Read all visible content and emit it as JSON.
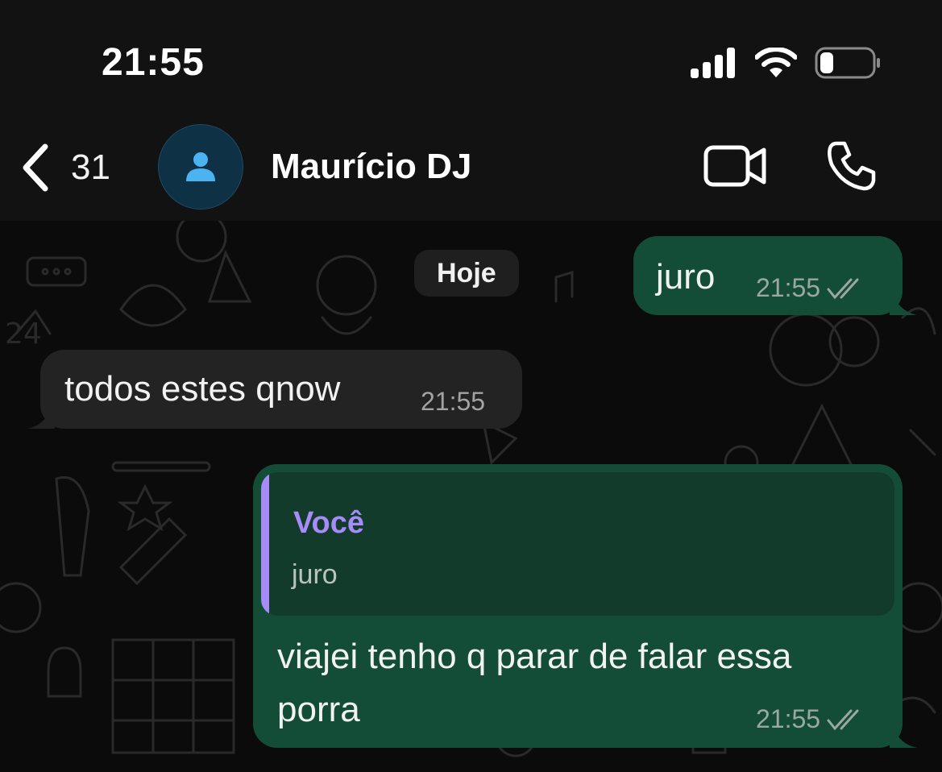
{
  "status_bar": {
    "time": "21:55"
  },
  "header": {
    "back_count": "31",
    "contact_name": "Maurício DJ",
    "icons": {
      "back": "chevron-left-icon",
      "avatar": "person-icon",
      "video": "video-camera-icon",
      "call": "phone-icon"
    }
  },
  "chat": {
    "date_chip": "Hoje",
    "messages": [
      {
        "direction": "outgoing",
        "text": "juro",
        "time": "21:55",
        "status": "read"
      },
      {
        "direction": "incoming",
        "text": "todos estes qnow",
        "time": "21:55"
      },
      {
        "direction": "outgoing",
        "reply_to": {
          "author": "Você",
          "text": "juro"
        },
        "text_line1": "viajei tenho q parar de falar essa",
        "text_line2": "porra",
        "time": "21:55",
        "status": "read"
      }
    ]
  },
  "colors": {
    "outgoing_bubble": "#144d37",
    "incoming_bubble": "#232323",
    "quote_accent": "#a78bf8",
    "avatar_bg": "#0f3146"
  }
}
